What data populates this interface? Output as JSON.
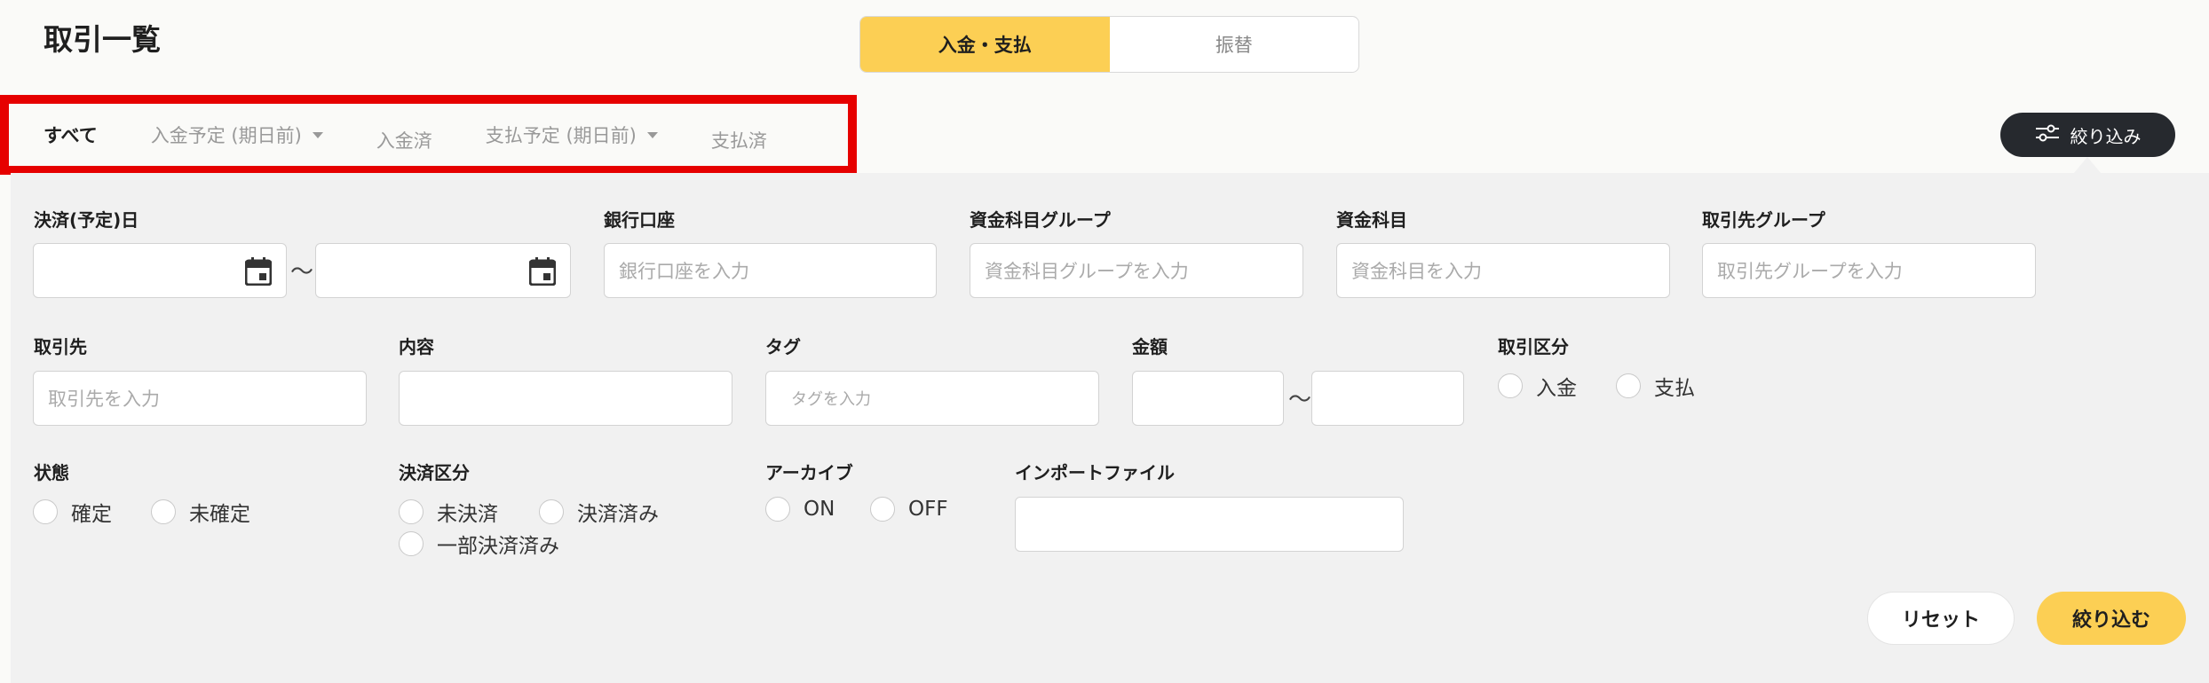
{
  "page": {
    "title": "取引一覧"
  },
  "mode_toggle": {
    "active": "入金・支払",
    "inactive": "振替"
  },
  "tabs": [
    {
      "label": "すべて",
      "active": true
    },
    {
      "label": "入金予定 (期日前)",
      "dropdown": true
    },
    {
      "label": "入金済"
    },
    {
      "label": "支払予定 (期日前)",
      "dropdown": true
    },
    {
      "label": "支払済"
    }
  ],
  "filter_button": {
    "label": "絞り込み",
    "icon": "filter-sliders-icon"
  },
  "form": {
    "settlement_date": {
      "label": "決済(予定)日",
      "separator": "〜",
      "icon": "calendar-icon"
    },
    "bank_account": {
      "label": "銀行口座",
      "placeholder": "銀行口座を入力"
    },
    "fund_group": {
      "label": "資金科目グループ",
      "placeholder": "資金科目グループを入力"
    },
    "fund_item": {
      "label": "資金科目",
      "placeholder": "資金科目を入力"
    },
    "partner_group": {
      "label": "取引先グループ",
      "placeholder": "取引先グループを入力"
    },
    "partner": {
      "label": "取引先",
      "placeholder": "取引先を入力"
    },
    "content": {
      "label": "内容",
      "placeholder": ""
    },
    "tag": {
      "label": "タグ",
      "placeholder": "タグを入力"
    },
    "amount": {
      "label": "金額",
      "separator": "〜"
    },
    "transaction_type": {
      "label": "取引区分",
      "options": [
        "入金",
        "支払"
      ]
    },
    "status": {
      "label": "状態",
      "options": [
        "確定",
        "未確定"
      ]
    },
    "settlement_type": {
      "label": "決済区分",
      "options": [
        "未決済",
        "決済済み",
        "一部決済済み"
      ]
    },
    "archive": {
      "label": "アーカイブ",
      "options": [
        "ON",
        "OFF"
      ]
    },
    "import_file": {
      "label": "インポートファイル",
      "placeholder": ""
    }
  },
  "actions": {
    "reset": "リセット",
    "apply": "絞り込む"
  },
  "colors": {
    "accent": "#fccf54",
    "dark_button": "#26292e",
    "highlight_border": "#e60000",
    "panel_bg": "#f1f1f1"
  }
}
